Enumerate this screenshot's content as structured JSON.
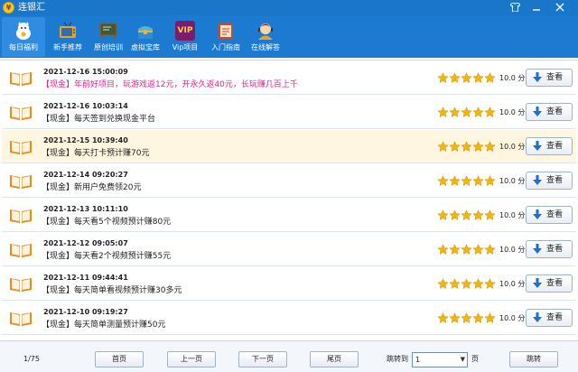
{
  "window": {
    "title": "连银汇",
    "controls": [
      "shirt-icon",
      "minimize-icon",
      "close-icon"
    ]
  },
  "toolbar": {
    "items": [
      {
        "label": "每日福利",
        "icon": "lucky-cat-icon",
        "active": true
      },
      {
        "label": "新手推荐",
        "icon": "tv-icon",
        "active": false
      },
      {
        "label": "原创培训",
        "icon": "chalkboard-icon",
        "active": false
      },
      {
        "label": "虚拟宝库",
        "icon": "treasure-chest-icon",
        "active": false
      },
      {
        "label": "Vip项目",
        "icon": "vip-icon",
        "vip_text": "VIP",
        "active": false
      },
      {
        "label": "入门指南",
        "icon": "guide-icon",
        "active": false
      },
      {
        "label": "在线解答",
        "icon": "support-agent-icon",
        "active": false
      }
    ]
  },
  "list": {
    "button_label": "查看",
    "score_unit": "分",
    "rows": [
      {
        "date": "2021-12-16 15:00:09",
        "title": "【现金】年前好项目，玩游戏返12元，开永久返40元，长玩赚几百上千",
        "score": "10.0",
        "stars": 5,
        "pink": true
      },
      {
        "date": "2021-12-16 10:03:14",
        "title": "【现金】每天签到兑换现金平台",
        "score": "10.0",
        "stars": 5,
        "pink": false
      },
      {
        "date": "2021-12-15 10:39:40",
        "title": "【现金】每天打卡预计赚70元",
        "score": "10.0",
        "stars": 5,
        "pink": false,
        "highlight": true
      },
      {
        "date": "2021-12-14 09:20:27",
        "title": "【现金】新用户免费领20元",
        "score": "10.0",
        "stars": 5,
        "pink": false
      },
      {
        "date": "2021-12-13 10:11:10",
        "title": "【现金】每天看5个视频预计赚80元",
        "score": "10.0",
        "stars": 5,
        "pink": false
      },
      {
        "date": "2021-12-12 09:05:07",
        "title": "【现金】每天看2个视频预计赚55元",
        "score": "10.0",
        "stars": 5,
        "pink": false
      },
      {
        "date": "2021-12-11 09:44:41",
        "title": "【现金】每天简单看视频预计赚30多元",
        "score": "10.0",
        "stars": 5,
        "pink": false
      },
      {
        "date": "2021-12-10 09:19:27",
        "title": "【现金】每天简单测量预计赚50元",
        "score": "10.0",
        "stars": 5,
        "pink": false
      }
    ]
  },
  "footer": {
    "page_info": "1/75",
    "first": "首页",
    "prev": "上一页",
    "next": "下一页",
    "last": "尾页",
    "jump_label": "跳转到",
    "jump_value": "1",
    "page_unit": "页",
    "jump_button": "跳转"
  },
  "colors": {
    "titlebar": "#1976c9",
    "toolbar": "#1c7ad0",
    "star": "#f2b50c",
    "pink_text": "#e0238d",
    "highlight_row": "#fff6e1",
    "book": "#e98a1e"
  }
}
